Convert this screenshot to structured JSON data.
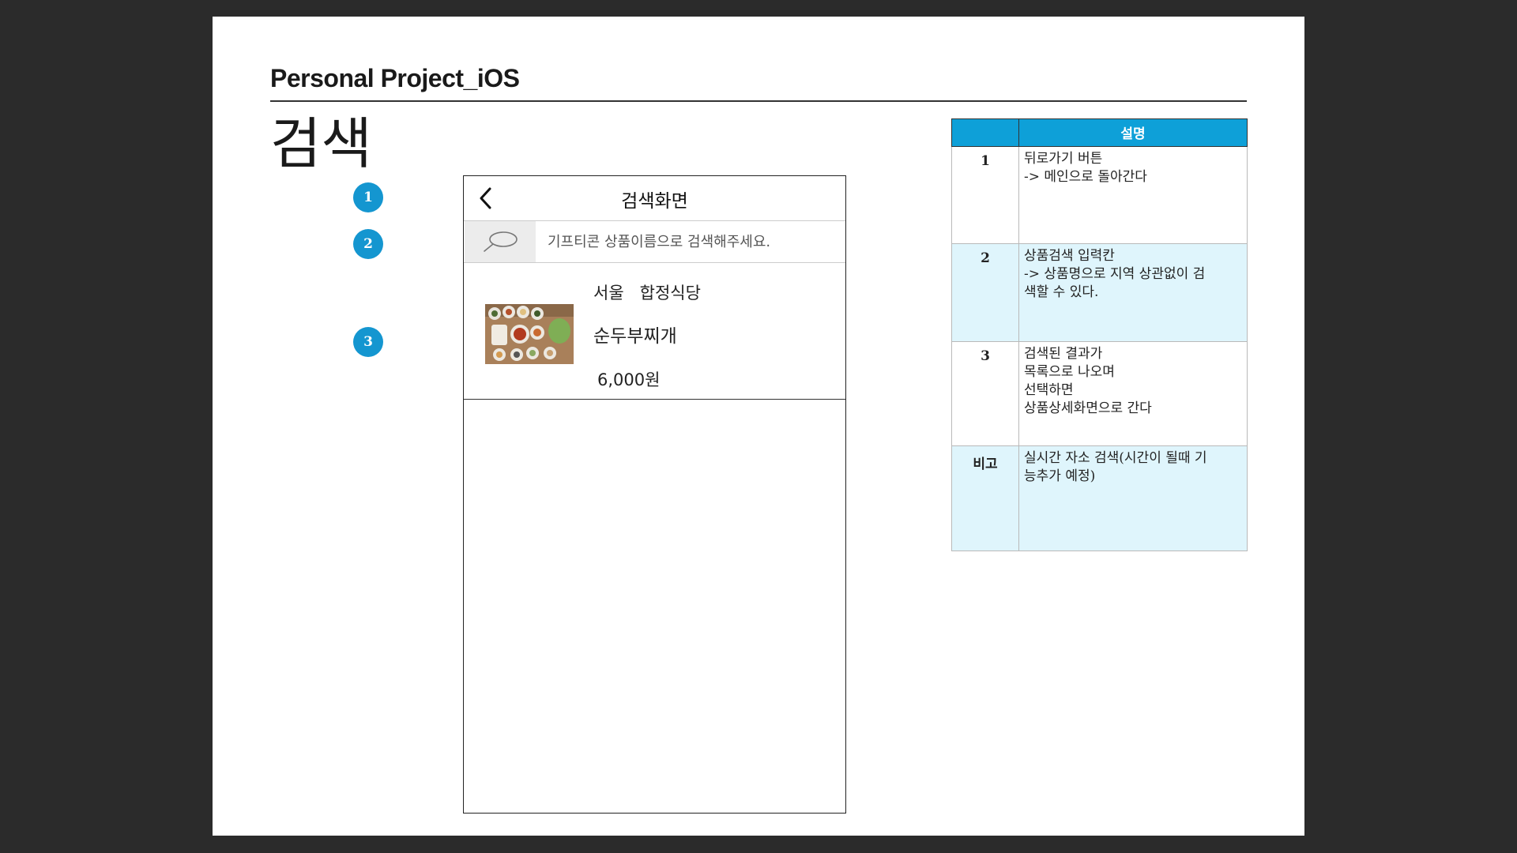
{
  "slide": {
    "header_title": "Personal Project_iOS",
    "section_title": "검색"
  },
  "phone": {
    "nav_title": "검색화면",
    "search_placeholder": "기프티콘 상품이름으로 검색해주세요.",
    "result": {
      "store": "서울   합정식당",
      "menu": "순두부찌개",
      "price": "6,000원"
    }
  },
  "markers": [
    "1",
    "2",
    "3"
  ],
  "table": {
    "header": "설명",
    "rows": [
      {
        "num": "1",
        "lines": [
          "뒤로가기 버튼",
          "-> 메인으로 돌아간다"
        ]
      },
      {
        "num": "2",
        "lines": [
          "상품검색 입력칸",
          "-> 상품명으로 지역 상관없이 검",
          "색할 수 있다."
        ]
      },
      {
        "num": "3",
        "lines": [
          "검색된 결과가",
          "목록으로 나오며",
          "선택하면",
          "상품상세화면으로 간다"
        ]
      },
      {
        "num": "비고",
        "lines": [
          "실시간 자소 검색(시간이 될때 기",
          "능추가 예정)"
        ]
      }
    ]
  },
  "colors": {
    "accent": "#1496d0",
    "table_header": "#0ea0d8",
    "row_highlight": "#dff5fc"
  }
}
